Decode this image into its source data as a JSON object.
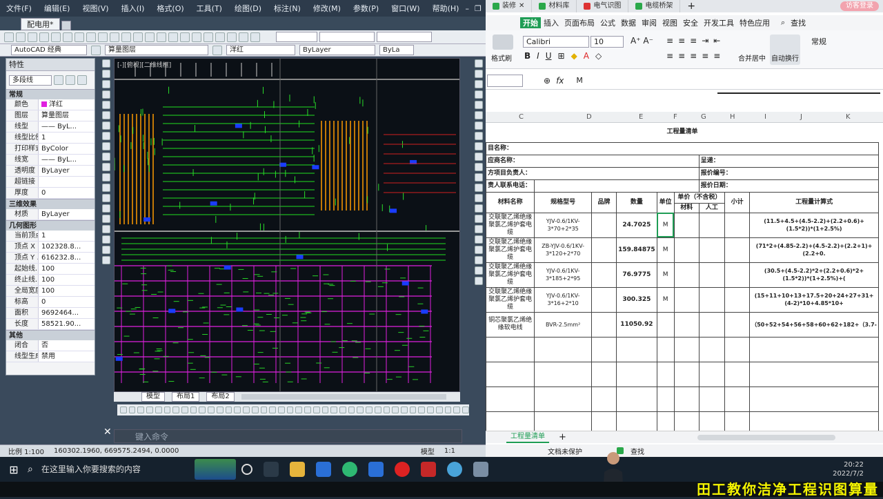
{
  "cad": {
    "menus": [
      "文件(F)",
      "编辑(E)",
      "视图(V)",
      "插入(I)",
      "格式(O)",
      "工具(T)",
      "绘图(D)",
      "标注(N)",
      "修改(M)",
      "参数(P)",
      "窗口(W)",
      "帮助(H)"
    ],
    "doc_tab": "配电用*",
    "workspace": "AutoCAD 经典",
    "layer": "算量图层",
    "color": "洋红",
    "linetype": "ByLayer",
    "lineweight": "ByLa",
    "props_title": "特性",
    "entity_type": "多段线",
    "sections": {
      "general": "常规",
      "threed": "三维效果",
      "geometry": "几何图形",
      "other": "其他"
    },
    "general": [
      {
        "k": "颜色",
        "v": "洋红"
      },
      {
        "k": "图层",
        "v": "算量图层"
      },
      {
        "k": "线型",
        "v": "—— ByL..."
      },
      {
        "k": "线型比例",
        "v": "1"
      },
      {
        "k": "打印样式",
        "v": "ByColor"
      },
      {
        "k": "线宽",
        "v": "—— ByL..."
      },
      {
        "k": "透明度",
        "v": "ByLayer"
      },
      {
        "k": "超链接",
        "v": ""
      },
      {
        "k": "厚度",
        "v": "0"
      }
    ],
    "threed": [
      {
        "k": "材质",
        "v": "ByLayer"
      }
    ],
    "geometry": [
      {
        "k": "当前顶点",
        "v": "1"
      },
      {
        "k": "顶点 X ...",
        "v": "102328.8..."
      },
      {
        "k": "顶点 Y ...",
        "v": "616232.8..."
      },
      {
        "k": "起始线...",
        "v": "100"
      },
      {
        "k": "终止线...",
        "v": "100"
      },
      {
        "k": "全局宽度",
        "v": "100"
      },
      {
        "k": "标高",
        "v": "0"
      },
      {
        "k": "面积",
        "v": "9692464..."
      },
      {
        "k": "长度",
        "v": "58521.90..."
      }
    ],
    "other": [
      {
        "k": "闭合",
        "v": "否"
      },
      {
        "k": "线型生成",
        "v": "禁用"
      }
    ],
    "view_label": "[-][俯视][二维线框]",
    "layout_tabs": [
      "模型",
      "布局1",
      "布局2"
    ],
    "cmd_placeholder": "键入命令",
    "status_scale": "比例 1:100",
    "status_coords": "160302.1960, 669575.2494, 0.0000",
    "status_model": "模型",
    "status_anno": "1:1"
  },
  "excel": {
    "tabs": [
      "装修",
      "材料库",
      "电气识图",
      "电缆桥架"
    ],
    "login": "访客登录",
    "menus": [
      "开始",
      "插入",
      "页面布局",
      "公式",
      "数据",
      "审阅",
      "视图",
      "安全",
      "开发工具",
      "特色应用"
    ],
    "find": "查找",
    "font": "Calibri",
    "font_size": "10",
    "number_format": "常规",
    "merge_label": "合并居中",
    "wrap_label": "自动换行",
    "paste_label": "格式刷",
    "formula_value": "M",
    "col_headers": [
      "C",
      "D",
      "E",
      "F",
      "G",
      "H",
      "I",
      "J",
      "K"
    ],
    "sheet_title": "工程量清单",
    "info": {
      "project": "目名称：",
      "supplier": "应商名称：",
      "manager": "方项目负责人：",
      "contact": "责人联系电话：",
      "to": "呈递：",
      "quote_no": "报价编号：",
      "quote_date": "报价日期："
    },
    "headers": {
      "name": "材料名称",
      "spec": "规格型号",
      "brand": "品牌",
      "qty": "数量",
      "unit": "单位",
      "price": "单价（不含税）",
      "material": "材料",
      "labor": "人工",
      "subtotal": "小计",
      "formula": "工程量计算式"
    },
    "rows": [
      {
        "name": "交联聚乙烯绝缘聚氯乙烯护套电缆",
        "spec": "YJV-0.6/1KV-3*70+2*35",
        "qty": "24.7025",
        "unit": "M",
        "formula": "(11.5+4.5+(4.5-2.2)+(2.2+0.6)+(1.5*2))*(1+2.5%)"
      },
      {
        "name": "交联聚乙烯绝缘聚氯乙烯护套电缆",
        "spec": "ZB-YJV-0.6/1KV-3*120+2*70",
        "qty": "159.84875",
        "unit": "M",
        "formula": "(71*2+(4.85-2.2)+(4.5-2.2)+(2.2+1)+(2.2+0."
      },
      {
        "name": "交联聚乙烯绝缘聚氯乙烯护套电缆",
        "spec": "YJV-0.6/1KV-3*185+2*95",
        "qty": "76.9775",
        "unit": "M",
        "formula": "(30.5+(4.5-2.2)*2+(2.2+0.6)*2+(1.5*2))*(1+2.5%)+("
      },
      {
        "name": "交联聚乙烯绝缘聚氯乙烯护套电缆",
        "spec": "YJV-0.6/1KV-3*16+2*10",
        "qty": "300.325",
        "unit": "M",
        "formula": "(15+11+10+13+17.5+20+24+27+31+(4-2)*10+4.85*10+"
      },
      {
        "name": "铜芯聚氯乙烯绝缘软电线",
        "spec": "BVR-2.5mm²",
        "qty": "11050.92",
        "unit": "",
        "formula": "（50+52+54+56+58+60+62+182+（3.7-"
      }
    ],
    "sheet_tab": "工程量清单",
    "status_protect": "文档未保护",
    "status_find": "查找"
  },
  "taskbar": {
    "search_placeholder": "在这里输入你要搜索的内容",
    "time": "20:22",
    "date": "2022/7/2"
  },
  "banner": "田工教你洁净工程识图算量"
}
